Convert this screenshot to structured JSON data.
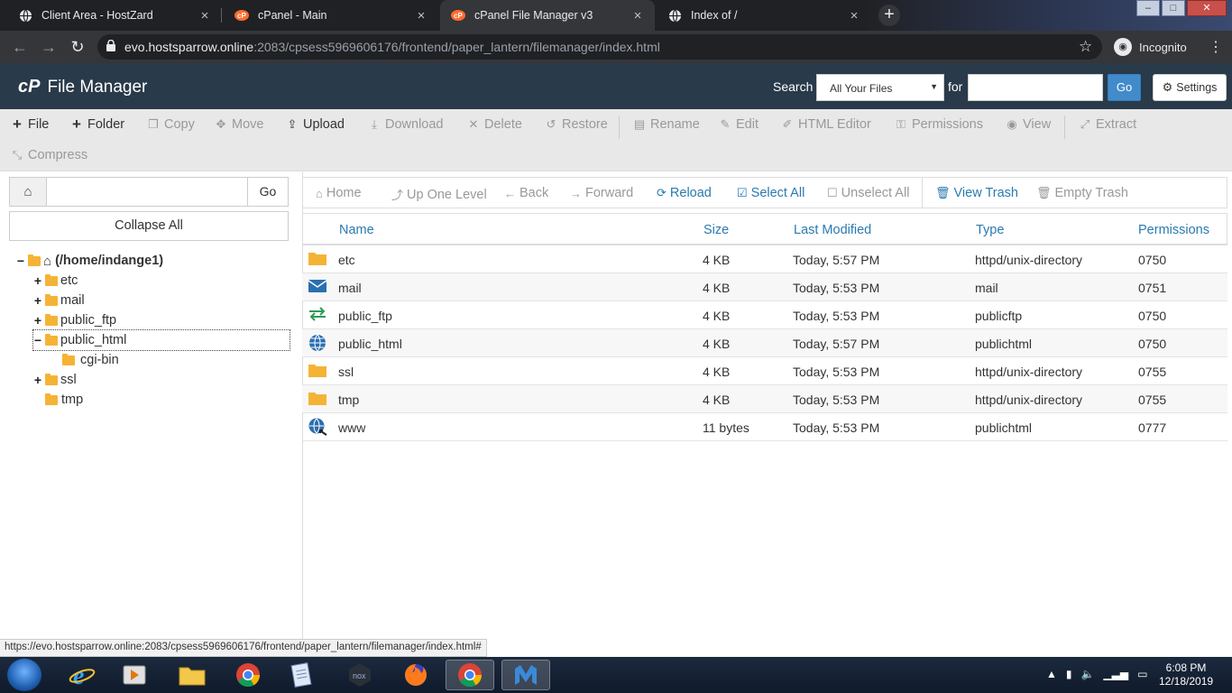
{
  "browser": {
    "tabs": [
      {
        "title": "Client Area - HostZard",
        "icon": "globe-icon",
        "active": false
      },
      {
        "title": "cPanel - Main",
        "icon": "cpanel-icon",
        "active": false
      },
      {
        "title": "cPanel File Manager v3",
        "icon": "cpanel-icon",
        "active": true
      },
      {
        "title": "Index of /",
        "icon": "globe-icon",
        "active": false
      }
    ],
    "new_tab": "+",
    "close_glyph": "×",
    "url_host": "evo.hostsparrow.online",
    "url_path": ":2083/cpsess5969606176/frontend/paper_lantern/filemanager/index.html",
    "profile_label": "Incognito"
  },
  "header": {
    "title": "File Manager",
    "logo": "cP",
    "search_label": "Search",
    "search_scope": "All Your Files",
    "for_label": "for",
    "search_value": "",
    "go_label": "Go",
    "settings_label": "Settings"
  },
  "toolbar": {
    "file": "File",
    "folder": "Folder",
    "copy": "Copy",
    "move": "Move",
    "upload": "Upload",
    "download": "Download",
    "delete": "Delete",
    "restore": "Restore",
    "rename": "Rename",
    "edit": "Edit",
    "html_editor": "HTML Editor",
    "permissions": "Permissions",
    "view": "View",
    "extract": "Extract",
    "compress": "Compress"
  },
  "tree": {
    "path_value": "",
    "go_label": "Go",
    "collapse_all": "Collapse All",
    "root": "(/home/indange1)",
    "items": [
      {
        "name": "etc",
        "toggle": "+"
      },
      {
        "name": "mail",
        "toggle": "+"
      },
      {
        "name": "public_ftp",
        "toggle": "+"
      },
      {
        "name": "public_html",
        "toggle": "−"
      },
      {
        "name": "cgi-bin",
        "toggle": ""
      },
      {
        "name": "ssl",
        "toggle": "+"
      },
      {
        "name": "tmp",
        "toggle": ""
      }
    ]
  },
  "nav": {
    "home": "Home",
    "up": "Up One Level",
    "back": "Back",
    "forward": "Forward",
    "reload": "Reload",
    "select_all": "Select All",
    "unselect_all": "Unselect All",
    "view_trash": "View Trash",
    "empty_trash": "Empty Trash"
  },
  "table": {
    "headers": {
      "name": "Name",
      "size": "Size",
      "modified": "Last Modified",
      "type": "Type",
      "perms": "Permissions"
    },
    "rows": [
      {
        "icon": "folder-icon",
        "name": "etc",
        "size": "4 KB",
        "modified": "Today, 5:57 PM",
        "type": "httpd/unix-directory",
        "perms": "0750"
      },
      {
        "icon": "mail-icon",
        "name": "mail",
        "size": "4 KB",
        "modified": "Today, 5:53 PM",
        "type": "mail",
        "perms": "0751"
      },
      {
        "icon": "ftp-icon",
        "name": "public_ftp",
        "size": "4 KB",
        "modified": "Today, 5:53 PM",
        "type": "publicftp",
        "perms": "0750"
      },
      {
        "icon": "globe-icon",
        "name": "public_html",
        "size": "4 KB",
        "modified": "Today, 5:57 PM",
        "type": "publichtml",
        "perms": "0750"
      },
      {
        "icon": "folder-icon",
        "name": "ssl",
        "size": "4 KB",
        "modified": "Today, 5:53 PM",
        "type": "httpd/unix-directory",
        "perms": "0755"
      },
      {
        "icon": "folder-icon",
        "name": "tmp",
        "size": "4 KB",
        "modified": "Today, 5:53 PM",
        "type": "httpd/unix-directory",
        "perms": "0755"
      },
      {
        "icon": "globe-link-icon",
        "name": "www",
        "size": "11 bytes",
        "modified": "Today, 5:53 PM",
        "type": "publichtml",
        "perms": "0777"
      }
    ]
  },
  "status_url": "https://evo.hostsparrow.online:2083/cpsess5969606176/frontend/paper_lantern/filemanager/index.html#",
  "taskbar": {
    "time": "6:08 PM",
    "date": "12/18/2019"
  },
  "colors": {
    "header_bg": "#293a4a",
    "link_blue": "#2a7ab0",
    "go_blue": "#428bca",
    "folder": "#f5b335"
  }
}
